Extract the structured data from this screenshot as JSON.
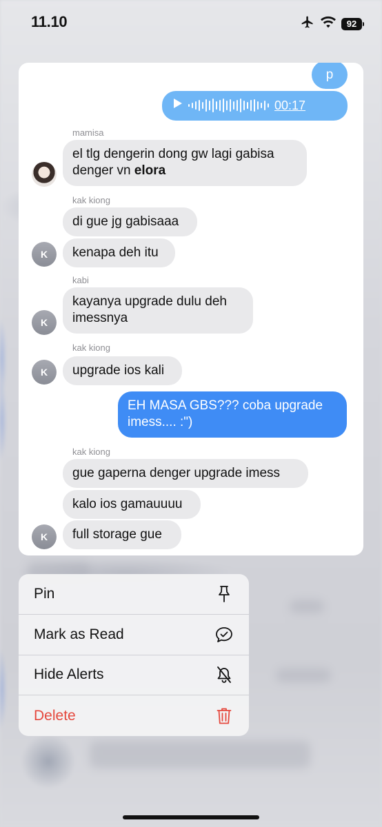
{
  "status_bar": {
    "time": "11.10",
    "battery": "92",
    "icons": [
      "airplane-icon",
      "wifi-icon",
      "battery-icon"
    ]
  },
  "preview": {
    "top_bubble": "p",
    "audio": {
      "duration": "00:17",
      "icons": [
        "play-icon"
      ]
    },
    "senders": [
      "mamisa",
      "kak kiong",
      "kabi",
      "kak kiong",
      "kak kiong"
    ],
    "messages": [
      {
        "line1": "el tlg dengerin dong gw lagi gabisa",
        "line2_pre": "denger vn ",
        "line2_bold": "elora"
      },
      {
        "text": "di gue jg gabisaaa"
      },
      {
        "text": "kenapa deh itu"
      },
      {
        "line1": "kayanya upgrade dulu deh",
        "line2": "imessnya"
      },
      {
        "text": "upgrade ios kali"
      },
      {
        "line1": "EH MASA GBS??? coba upgrade",
        "line2": "imess.... :\")"
      },
      {
        "text": "gue gaperna denger upgrade imess"
      },
      {
        "text": "kalo ios gamauuuu"
      },
      {
        "text": "full storage gue"
      }
    ],
    "avatar_initial": "K",
    "colors": {
      "outgoing": "#3f8cf5",
      "outgoing_light": "#6fb6f6",
      "incoming": "#e9e9eb"
    }
  },
  "menu": {
    "items": [
      {
        "label": "Pin",
        "icon": "pin-icon"
      },
      {
        "label": "Mark as Read",
        "icon": "message-check-icon"
      },
      {
        "label": "Hide Alerts",
        "icon": "bell-slash-icon"
      },
      {
        "label": "Delete",
        "icon": "trash-icon"
      }
    ],
    "danger_color": "#e5483d"
  }
}
